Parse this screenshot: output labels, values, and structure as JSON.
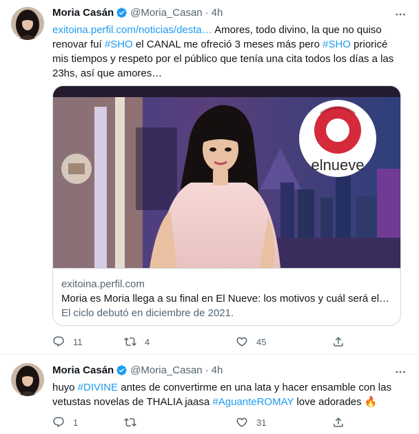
{
  "tweets": [
    {
      "author": {
        "name": "Moria Casán",
        "handle": "@Moria_Casan",
        "separator": "·",
        "time": "4h"
      },
      "text": {
        "link": "exitoina.perfil.com/noticias/desta…",
        "part1": " Amores, todo divino, la que no quiso renovar fuí ",
        "hashtag1": "#SHO",
        "part2": " el CANAL me ofreció 3 meses más pero ",
        "hashtag2": "#SHO",
        "part3": " prioricé mis tiempos y respeto por el público que tenía una cita todos los días a las 23hs, así que amores…"
      },
      "card": {
        "image_logo_text": "elnueve",
        "domain": "exitoina.perfil.com",
        "title": "Moria es Moria llega a su final en El Nueve: los motivos y cuál será el futuro de la diva",
        "description": "El ciclo debutó en diciembre de 2021."
      },
      "actions": {
        "replies": "11",
        "retweets": "4",
        "likes": "45"
      }
    },
    {
      "author": {
        "name": "Moria Casán",
        "handle": "@Moria_Casan",
        "separator": "·",
        "time": "4h"
      },
      "text": {
        "part1": "huyo ",
        "hashtag1": "#DIVINE",
        "part2": " antes de convertirme en una lata y hacer ensamble con las vetustas novelas de THALIA jaasa ",
        "hashtag2": "#AguanteROMAY",
        "part3": " love adorades ",
        "emoji": "🔥"
      },
      "actions": {
        "replies": "1",
        "retweets": "",
        "likes": "31"
      }
    }
  ],
  "icons": {
    "verified": "verified-badge-icon",
    "more": "more-horizontal-icon",
    "reply": "reply-icon",
    "retweet": "retweet-icon",
    "like": "heart-icon",
    "share": "share-icon"
  },
  "colors": {
    "accent": "#1d9bf0",
    "text": "#0f1419",
    "secondary": "#536471",
    "border": "#cfd9de",
    "fire": "#f4900c"
  }
}
